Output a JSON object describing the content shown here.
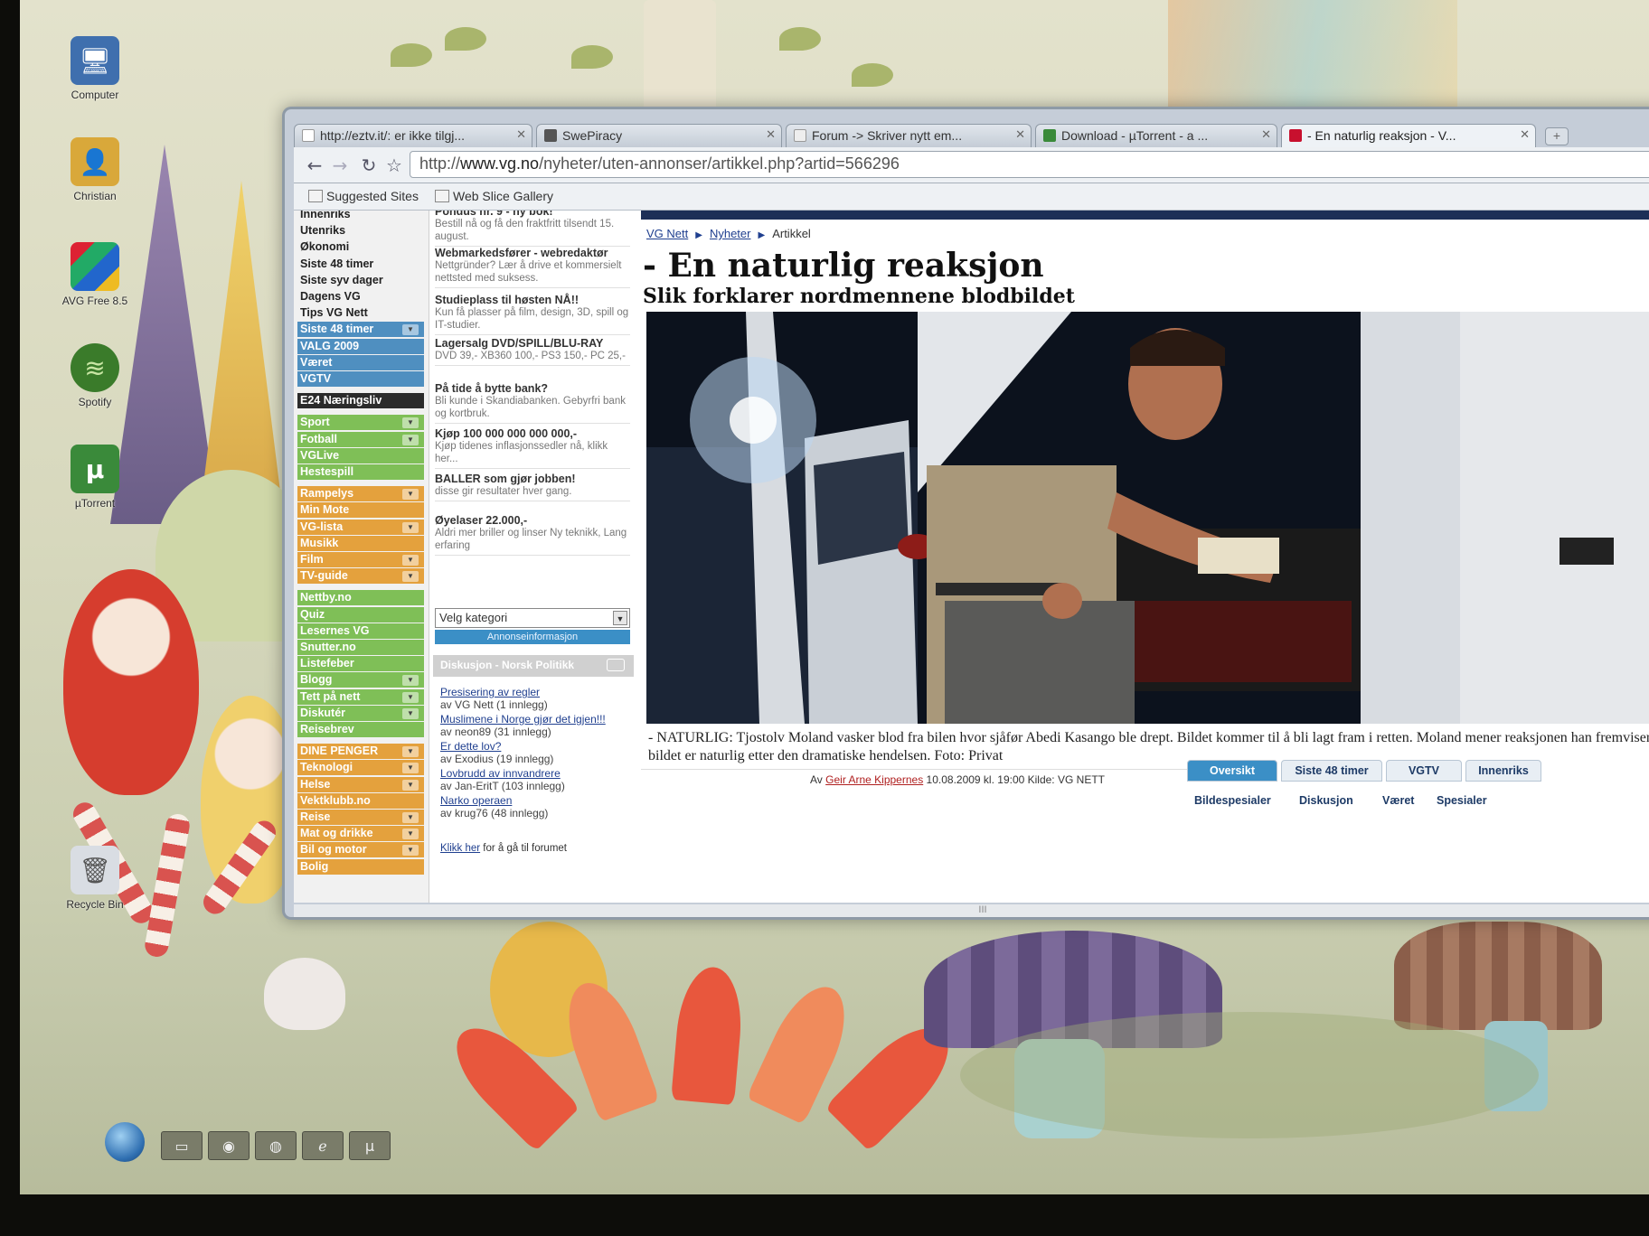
{
  "desktop": {
    "icons": [
      {
        "label": "Computer",
        "icon": "computer-icon"
      },
      {
        "label": "Christian",
        "icon": "user-folder-icon"
      },
      {
        "label": "AVG Free 8.5",
        "icon": "avg-icon"
      },
      {
        "label": "Spotify",
        "icon": "spotify-icon"
      },
      {
        "label": "µTorrent",
        "icon": "utorrent-icon"
      },
      {
        "label": "Recycle Bin",
        "icon": "recycle-bin-icon"
      }
    ]
  },
  "browser": {
    "tabs": [
      {
        "label": "http://eztv.it/: er ikke tilgj...",
        "active": false
      },
      {
        "label": "SwePiracy",
        "active": false
      },
      {
        "label": "Forum -> Skriver nytt em...",
        "active": false
      },
      {
        "label": "Download - µTorrent - a ...",
        "active": false
      },
      {
        "label": "- En naturlig reaksjon - V...",
        "active": true
      }
    ],
    "new_tab": "+",
    "url_prefix": "http://",
    "url_domain": "www.vg.no",
    "url_path": "/nyheter/uten-annonser/artikkel.php?artid=566296",
    "bookmarks": [
      "Suggested Sites",
      "Web Slice Gallery"
    ],
    "status_text": "III"
  },
  "leftnav": [
    {
      "label": "Innenriks",
      "style": "plain"
    },
    {
      "label": "Utenriks",
      "style": "plain"
    },
    {
      "label": "Økonomi",
      "style": "plain"
    },
    {
      "label": "Siste 48 timer",
      "style": "plain"
    },
    {
      "label": "Siste syv dager",
      "style": "plain"
    },
    {
      "label": "Dagens VG",
      "style": "plain"
    },
    {
      "label": "Tips VG Nett",
      "style": "plain"
    },
    {
      "label": "Siste 48 timer",
      "style": "blue",
      "arrow": true
    },
    {
      "label": "VALG 2009",
      "style": "blue"
    },
    {
      "label": "Været",
      "style": "blue"
    },
    {
      "label": "VGTV",
      "style": "blue"
    },
    {
      "label": "E24 Næringsliv",
      "style": "dark"
    },
    {
      "label": "Sport",
      "style": "green",
      "arrow": true
    },
    {
      "label": "Fotball",
      "style": "green",
      "arrow": true
    },
    {
      "label": "VGLive",
      "style": "green"
    },
    {
      "label": "Hestespill",
      "style": "green"
    },
    {
      "label": "Rampelys",
      "style": "orange",
      "arrow": true
    },
    {
      "label": "Min Mote",
      "style": "orange"
    },
    {
      "label": "VG-lista",
      "style": "orange",
      "arrow": true
    },
    {
      "label": "Musikk",
      "style": "orange"
    },
    {
      "label": "Film",
      "style": "orange",
      "arrow": true
    },
    {
      "label": "TV-guide",
      "style": "orange",
      "arrow": true
    },
    {
      "label": "Nettby.no",
      "style": "green"
    },
    {
      "label": "Quiz",
      "style": "green"
    },
    {
      "label": "Lesernes VG",
      "style": "green"
    },
    {
      "label": "Snutter.no",
      "style": "green"
    },
    {
      "label": "Listefeber",
      "style": "green"
    },
    {
      "label": "Blogg",
      "style": "green",
      "arrow": true
    },
    {
      "label": "Tett på nett",
      "style": "green",
      "arrow": true
    },
    {
      "label": "Diskutér",
      "style": "green",
      "arrow": true
    },
    {
      "label": "Reisebrev",
      "style": "green"
    },
    {
      "label": "DINE PENGER",
      "style": "orange",
      "arrow": true
    },
    {
      "label": "Teknologi",
      "style": "orange",
      "arrow": true
    },
    {
      "label": "Helse",
      "style": "orange",
      "arrow": true
    },
    {
      "label": "Vektklubb.no",
      "style": "orange"
    },
    {
      "label": "Reise",
      "style": "orange",
      "arrow": true
    },
    {
      "label": "Mat og drikke",
      "style": "orange",
      "arrow": true
    },
    {
      "label": "Bil og motor",
      "style": "orange",
      "arrow": true
    },
    {
      "label": "Bolig",
      "style": "orange"
    }
  ],
  "ads": [
    {
      "title": "Pondus nr. 9 - ny bok!",
      "desc": "Bestill nå og få den fraktfritt tilsendt 15. august."
    },
    {
      "title": "Webmarkedsfører - webredaktør",
      "desc": "Nettgründer? Lær å drive et kommersielt nettsted med suksess."
    },
    {
      "title": "Studieplass til høsten NÅ!!",
      "desc": "Kun få plasser på film, design, 3D, spill og IT-studier."
    },
    {
      "title": "Lagersalg DVD/SPILL/BLU-RAY",
      "desc": "DVD 39,- XB360 100,- PS3 150,- PC 25,-"
    },
    {
      "title": "På tide å bytte bank?",
      "desc": "Bli kunde i Skandiabanken. Gebyrfri bank og kortbruk."
    },
    {
      "title": "Kjøp 100 000 000 000 000,-",
      "desc": "Kjøp tidenes inflasjonssedler nå, klikk her..."
    },
    {
      "title": "BALLER som gjør jobben!",
      "desc": "disse gir resultater hver gang."
    },
    {
      "title": "Øyelaser 22.000,-",
      "desc": "Aldri mer briller og linser Ny teknikk, Lang erfaring"
    }
  ],
  "ad_select": "Velg kategori",
  "ad_info": "Annonseinformasjon",
  "forum": {
    "title": "Diskusjon - Norsk Politikk",
    "posts": [
      {
        "title": "Presisering av regler",
        "meta": "av VG Nett (1 innlegg)"
      },
      {
        "title": "Muslimene i Norge gjør det igjen!!!",
        "meta": "av neon89 (31 innlegg)"
      },
      {
        "title": "Er dette lov?",
        "meta": "av Exodius (19 innlegg)"
      },
      {
        "title": "Lovbrudd av innvandrere",
        "meta": "av Jan-EritT (103 innlegg)"
      },
      {
        "title": "Narko operaen",
        "meta": "av krug76 (48 innlegg)"
      }
    ],
    "footer_link": "Klikk her",
    "footer_text": " for å gå til forumet"
  },
  "article": {
    "breadcrumb": [
      "VG Nett",
      "Nyheter",
      "Artikkel"
    ],
    "headline": "- En naturlig reaksjon",
    "subheadline": "Slik forklarer nordmennene blodbildet",
    "caption": "- NATURLIG: Tjostolv Moland vasker blod fra bilen hvor sjåfør Abedi Kasango ble drept. Bildet kommer til å bli lagt fram i retten. Moland mener reaksjonen han fremviser på bildet er naturlig etter den dramatiske hendelsen. Foto: Privat",
    "byline_prefix": "Av ",
    "author": "Geir Arne Kippernes",
    "byline_suffix": " 10.08.2009 kl. 19:00 Kilde: VG NETT",
    "tabs_row1": [
      "Oversikt",
      "Siste 48 timer",
      "VGTV",
      "Innenriks"
    ],
    "tabs_row2": [
      "Bildespesialer",
      "Diskusjon",
      "Været",
      "Spesialer"
    ]
  },
  "colors": {
    "vg_blue": "#3b8fc6",
    "vg_navy": "#1d2f57",
    "link": "#1f3f8f",
    "author_red": "#b02020"
  }
}
